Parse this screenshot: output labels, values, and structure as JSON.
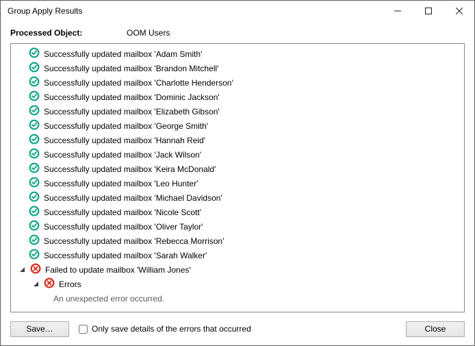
{
  "window": {
    "title": "Group Apply Results"
  },
  "header": {
    "label": "Processed Object:",
    "value": "OOM Users"
  },
  "results": [
    {
      "status": "ok",
      "text": "Successfully updated mailbox 'Adam Smith'"
    },
    {
      "status": "ok",
      "text": "Successfully updated mailbox 'Brandon Mitchell'"
    },
    {
      "status": "ok",
      "text": "Successfully updated mailbox 'Charlotte Henderson'"
    },
    {
      "status": "ok",
      "text": "Successfully updated mailbox 'Dominic Jackson'"
    },
    {
      "status": "ok",
      "text": "Successfully updated mailbox 'Elizabeth Gibson'"
    },
    {
      "status": "ok",
      "text": "Successfully updated mailbox 'George Smith'"
    },
    {
      "status": "ok",
      "text": "Successfully updated mailbox 'Hannah Reid'"
    },
    {
      "status": "ok",
      "text": "Successfully updated mailbox 'Jack Wilson'"
    },
    {
      "status": "ok",
      "text": "Successfully updated mailbox 'Keira McDonald'"
    },
    {
      "status": "ok",
      "text": "Successfully updated mailbox 'Leo Hunter'"
    },
    {
      "status": "ok",
      "text": "Successfully updated mailbox 'Michael Davidson'"
    },
    {
      "status": "ok",
      "text": "Successfully updated mailbox 'Nicole Scott'"
    },
    {
      "status": "ok",
      "text": "Successfully updated mailbox 'Oliver Taylor'"
    },
    {
      "status": "ok",
      "text": "Successfully updated mailbox 'Rebecca Morrison'"
    },
    {
      "status": "ok",
      "text": "Successfully updated mailbox 'Sarah Walker'"
    }
  ],
  "failure": {
    "text": "Failed to update mailbox 'William Jones'",
    "errors_label": "Errors",
    "error_message": "An unexpected error occurred."
  },
  "footer": {
    "save_label": "Save…",
    "checkbox_label": "Only save details of the errors that occurred",
    "close_label": "Close"
  }
}
